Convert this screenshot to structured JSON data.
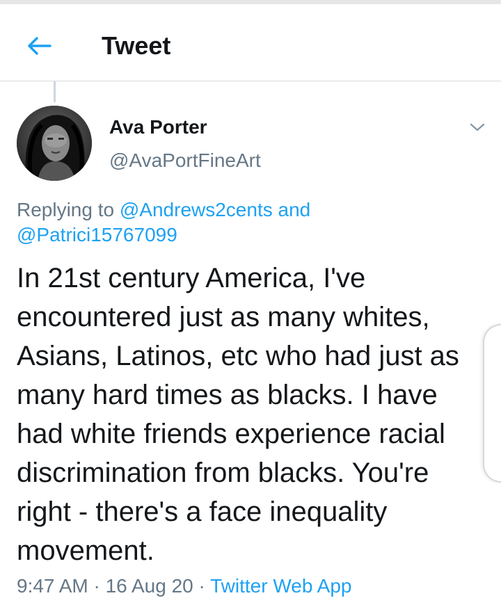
{
  "header": {
    "title": "Tweet",
    "back_icon": "arrow-left-icon"
  },
  "tweet": {
    "author_name": "Ava Porter",
    "author_handle": "@AvaPortFineArt",
    "replying_prefix": "Replying to",
    "mention_1": "@Andrews2cents",
    "replying_joiner": "and",
    "mention_2": "@Patrici15767099",
    "text": "In 21st century America, I've encountered just as many whites, Asians, Latinos, etc who had just as many hard times as blacks.  I have had white friends experience racial discrimination from blacks. You're right - there's a face inequality movement.",
    "timestamp_partial": "9:47 AM · 16 Aug 20 ·",
    "source_partial": "Twitter Web App"
  },
  "colors": {
    "accent": "#1da1f2",
    "secondary_text": "#657786",
    "primary_text": "#14171a",
    "divider": "#d6dbdf"
  }
}
